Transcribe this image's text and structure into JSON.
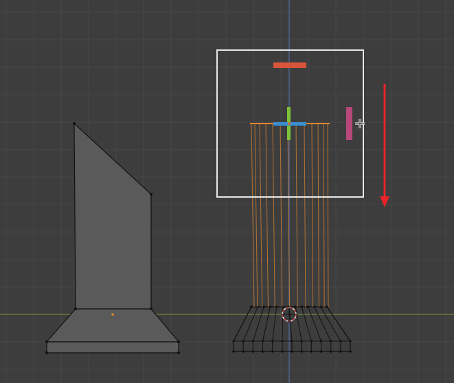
{
  "viewport": {
    "view": "front-orthographic",
    "mode": "edit",
    "grid": true,
    "colors": {
      "background": "#3d3d3d",
      "grid_line": "#474747",
      "x_axis": "#7a9a3c",
      "z_axis": "#4f6fa8",
      "mesh_face": "#5a5a5a",
      "mesh_edge": "#111111",
      "selected_edge": "#e0862e",
      "gizmo_box": "#e8e8e8",
      "gizmo_x": "#d8553a",
      "gizmo_y": "#7ec23a",
      "gizmo_z": "#3a8fd0",
      "gizmo_view": "#b8477a",
      "cursor_3d": "#e04040",
      "annotation_arrow": "#e8242a"
    }
  },
  "objects": [
    {
      "name": "slanted-pedestal",
      "selected": false
    },
    {
      "name": "cylinder-pedestal",
      "selected": true,
      "selected_part": "top-edge-loop"
    }
  ],
  "gizmo": {
    "type": "move",
    "handles": [
      "x-plane-handle",
      "y-axis-handle",
      "z-axis-handle",
      "view-handle"
    ]
  },
  "annotation": {
    "icon": "arrow-down-icon"
  }
}
